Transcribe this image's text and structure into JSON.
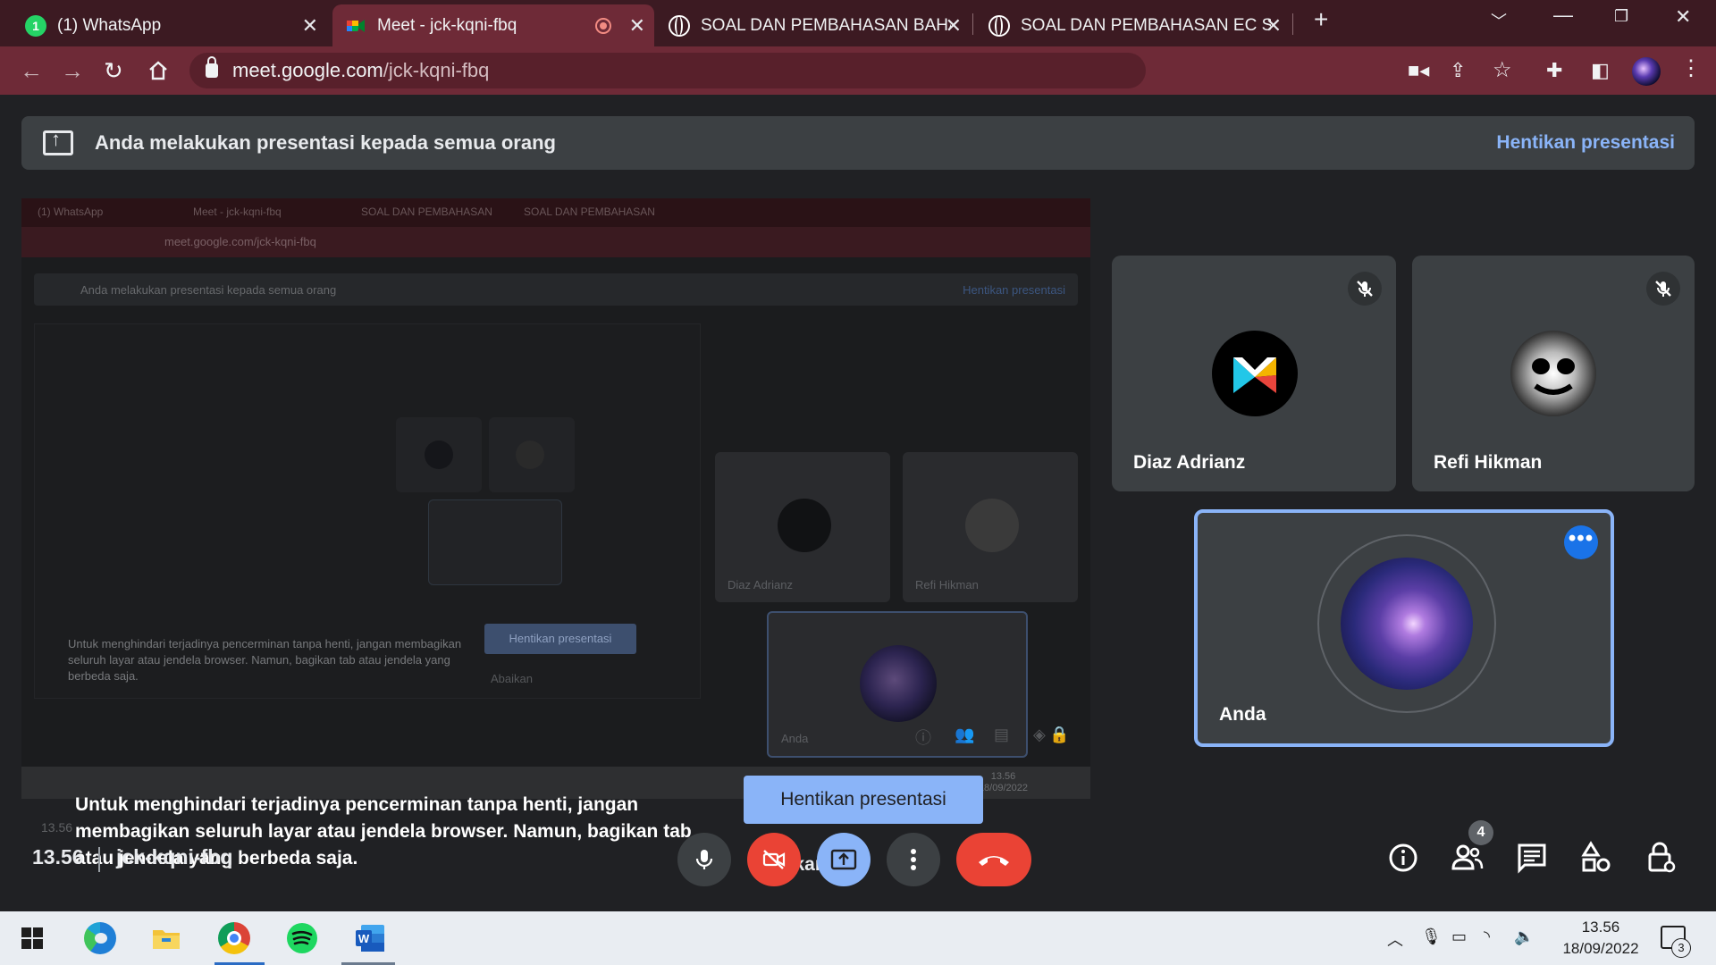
{
  "browser": {
    "tabs": [
      {
        "title": "(1) WhatsApp",
        "active": false,
        "favicon": "whatsapp-icon"
      },
      {
        "title": "Meet - jck-kqni-fbq",
        "active": true,
        "favicon": "google-meet-icon",
        "recording": true
      },
      {
        "title": "SOAL DAN PEMBAHASAN BAHA",
        "active": false,
        "favicon": "globe-icon"
      },
      {
        "title": "SOAL DAN PEMBAHASAN EC SM",
        "active": false,
        "favicon": "globe-icon"
      }
    ],
    "wa_badge": "1",
    "url_host": "meet.google.com",
    "url_path": "/jck-kqni-fbq"
  },
  "meet": {
    "banner_text": "Anda melakukan presentasi kepada semua orang",
    "banner_stop": "Hentikan presentasi",
    "mirror_message": "Untuk menghindari terjadinya pencerminan tanpa henti, jangan membagikan seluruh layar atau jendela browser. Namun, bagikan tab atau jendela yang berbeda saja.",
    "stop_button": "Hentikan presentasi",
    "ignore_label": "Abaikan",
    "participants": [
      {
        "name": "Diaz Adrianz",
        "muted": true
      },
      {
        "name": "Refi Hikman",
        "muted": true
      },
      {
        "name": "Anda",
        "self": true
      }
    ],
    "time": "13.56",
    "meeting_code": "jck-kqni-fbq",
    "people_count": "4"
  },
  "preview": {
    "tabs": [
      "(1) WhatsApp",
      "Meet - jck-kqni-fbq",
      "SOAL DAN PEMBAHASAN BAHA",
      "SOAL DAN PEMBAHASAN EC SM"
    ],
    "url": "meet.google.com/jck-kqni-fbq",
    "banner_text": "Anda melakukan presentasi kepada semua orang",
    "banner_stop": "Hentikan presentasi",
    "names": [
      "Diaz Adrianz",
      "Refi Hikman",
      "Anda"
    ],
    "message": "Untuk menghindari terjadinya pencerminan tanpa henti, jangan membagikan seluruh layar atau jendela browser. Namun, bagikan tab atau jendela yang berbeda saja.",
    "stop_button": "Hentikan presentasi",
    "ignore": "Abaikan",
    "time": "13.56",
    "code": "jck-kqni-fbq",
    "clock_time": "13.56",
    "clock_date": "18/09/2022"
  },
  "taskbar": {
    "apps": [
      "windows-start-icon",
      "edge-icon",
      "file-explorer-icon",
      "chrome-icon",
      "spotify-icon",
      "word-icon"
    ],
    "time": "13.56",
    "date": "18/09/2022",
    "notifications": "3"
  },
  "colors": {
    "tab_bg": "#3c1a22",
    "active_tab": "#6e2a37",
    "meet_bg": "#202124",
    "accent_blue": "#8ab4f8",
    "red": "#ea4335"
  }
}
